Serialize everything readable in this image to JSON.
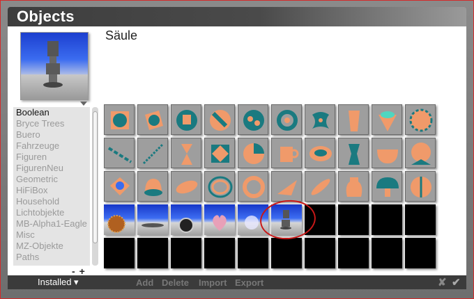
{
  "window": {
    "title": "Objects"
  },
  "preview": {
    "object_name": "Säule"
  },
  "categories": {
    "items": [
      "Boolean",
      "Bryce Trees",
      "Buero",
      "Fahrzeuge",
      "Figuren",
      "FigurenNeu",
      "Geometric",
      "HiFiBox",
      "Household",
      "Lichtobjekte",
      "MB-Alpha1-Eagle",
      "Misc",
      "MZ-Objekte",
      "Paths"
    ],
    "selected_index": 0,
    "remove_label": "-",
    "add_label": "+"
  },
  "grid": {
    "rows": [
      [
        "cube-sphere",
        "cube-cut",
        "sphere-cube",
        "sphere-boolean",
        "sphere-holes",
        "torus-knot",
        "twisted-shape",
        "vase-fluted",
        "cup-shape",
        "gear-flower"
      ],
      [
        "chain",
        "spring-twist",
        "hourglass",
        "cube-diamond",
        "sphere-slice",
        "mug",
        "ring-bowl",
        "vase-teal",
        "bowl",
        "cube-corner"
      ],
      [
        "eye-cube",
        "bell",
        "lens",
        "ring-spiral",
        "torus",
        "wedge",
        "leaf",
        "jar",
        "mushroom",
        "sphere-split"
      ],
      [
        "wood-sphere",
        "floor-thin",
        "disk-stack",
        "heart",
        "glass-sphere",
        "column",
        "empty",
        "empty",
        "empty",
        "empty"
      ],
      [
        "empty",
        "empty",
        "empty",
        "empty",
        "empty",
        "empty",
        "empty",
        "empty",
        "empty",
        "empty"
      ]
    ]
  },
  "bottombar": {
    "source_label": "Installed",
    "add_label": "Add",
    "delete_label": "Delete",
    "import_label": "Import",
    "export_label": "Export",
    "cancel_icon": "✘",
    "ok_icon": "✔"
  },
  "colors": {
    "teal": "#1a7a80",
    "orange": "#f09a6a",
    "highlight": "#c81818"
  }
}
